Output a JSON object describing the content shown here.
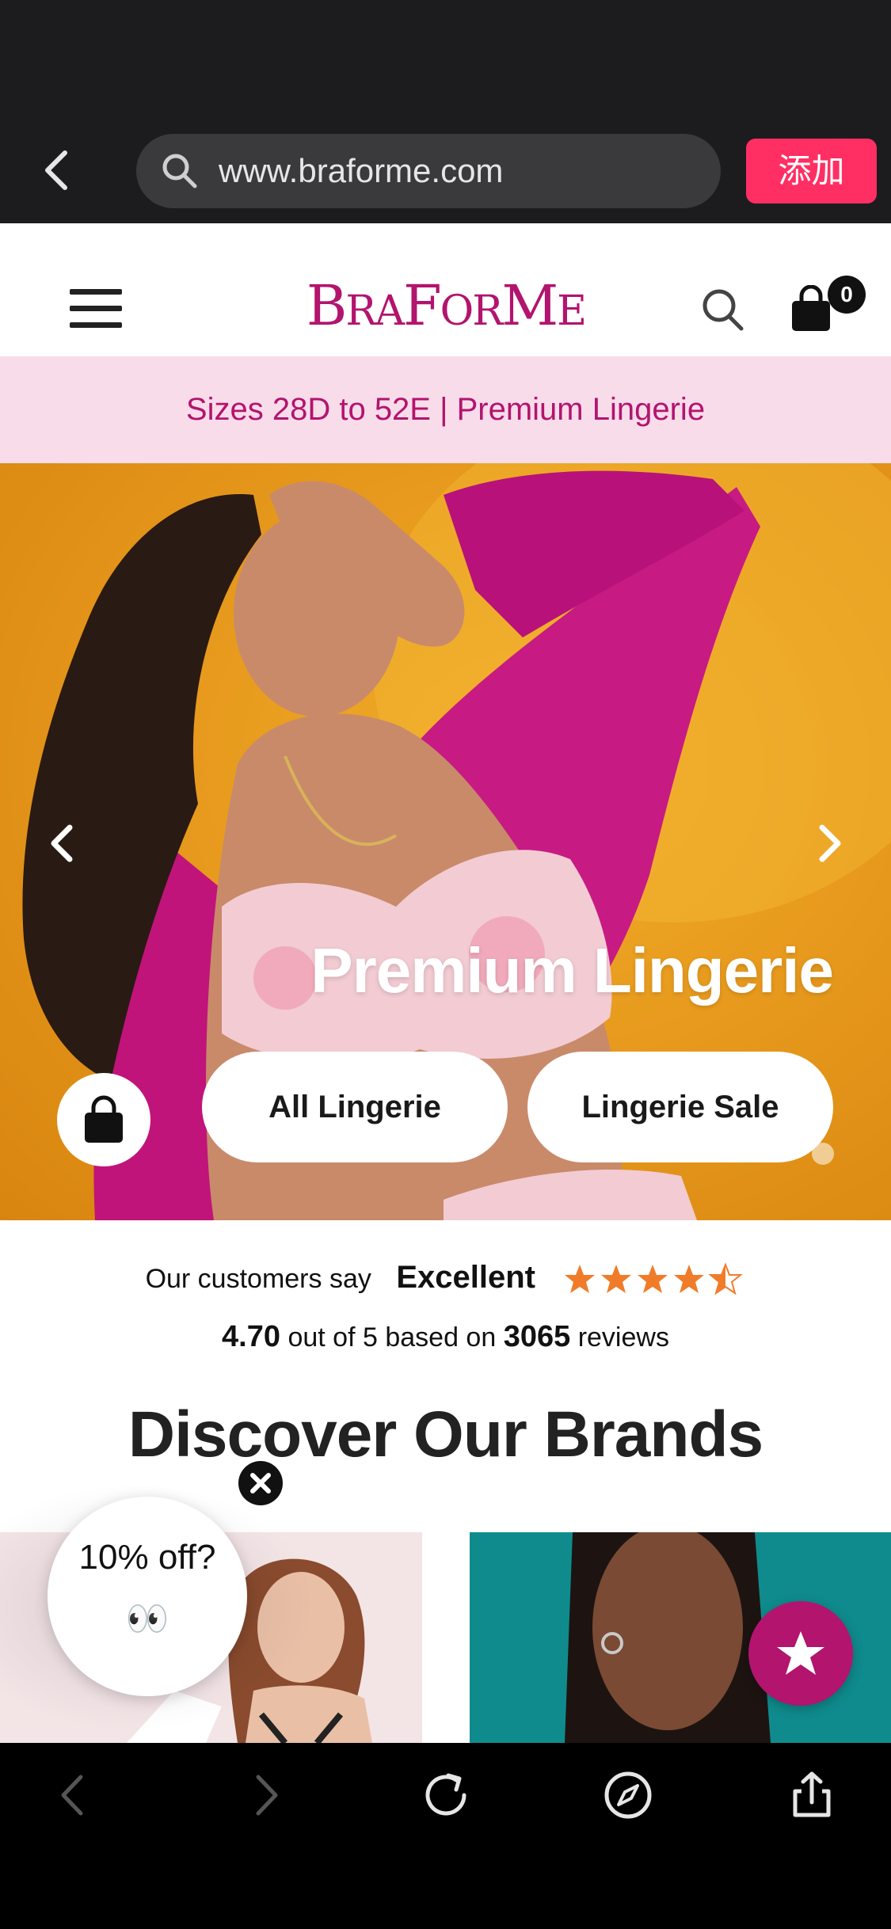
{
  "browser": {
    "url": "www.braforme.com",
    "add_button_label": "添加"
  },
  "header": {
    "logo_text": "BraForMe",
    "cart_count": "0"
  },
  "announcement": {
    "text": "Sizes 28D to 52E | Premium Lingerie"
  },
  "hero": {
    "title": "Premium Lingerie",
    "buttons": [
      {
        "label": "All Lingerie"
      },
      {
        "label": "Lingerie Sale"
      }
    ]
  },
  "reviews": {
    "prefix": "Our customers say",
    "rating_word": "Excellent",
    "stars": 4.5,
    "score": "4.70",
    "score_suffix": "out of 5 based on",
    "count": "3065",
    "count_suffix": "reviews"
  },
  "brands": {
    "heading": "Discover Our Brands"
  },
  "popup": {
    "text": "10% off?",
    "emoji": "👀"
  },
  "colors": {
    "brand": "#b2146e",
    "announcement_bg": "#f9dcea",
    "browser_add": "#ff2e63",
    "star": "#f07c2a"
  }
}
